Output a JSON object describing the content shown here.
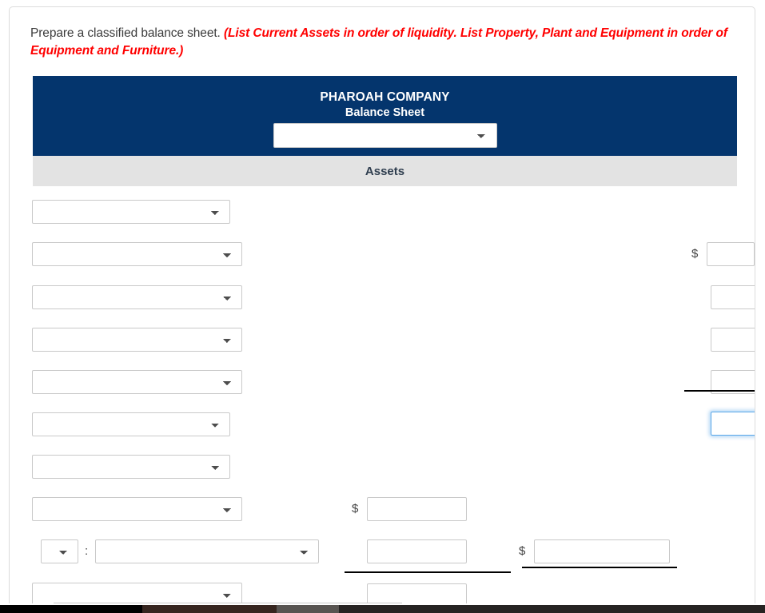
{
  "instructions": {
    "prompt": "Prepare a classified balance sheet.",
    "hint": "(List Current Assets in order of liquidity. List Property, Plant and Equipment in order of Equipment and Furniture.)"
  },
  "statement": {
    "company_name": "PHAROAH COMPANY",
    "statement_title": "Balance Sheet",
    "date_select_value": "",
    "date_select_placeholder": "",
    "section_header": "Assets"
  },
  "symbols": {
    "dollar": "$",
    "colon": ":"
  },
  "rows": [
    {
      "id": "row-1",
      "label_value": "",
      "amount_value": ""
    },
    {
      "id": "row-2",
      "label_value": "",
      "amount_value": ""
    },
    {
      "id": "row-3",
      "label_value": "",
      "amount_value": ""
    },
    {
      "id": "row-4",
      "label_value": "",
      "amount_value": ""
    },
    {
      "id": "row-5",
      "label_value": "",
      "amount_value": ""
    },
    {
      "id": "row-6",
      "label_value": "",
      "amount_value": ""
    },
    {
      "id": "row-7",
      "label_value": "",
      "amount_value": ""
    },
    {
      "id": "row-8",
      "label_value": "",
      "amount_value": ""
    },
    {
      "id": "row-9",
      "label_value": "",
      "amount_value": ""
    },
    {
      "id": "row-10",
      "label_value": "",
      "amount_value": ""
    }
  ],
  "colors": {
    "header_navy": "#04356d",
    "section_gray": "#e3e3e3",
    "hint_red": "#ff0000",
    "focus_blue": "#5aa7e8",
    "field_border": "#c9c9c9"
  }
}
